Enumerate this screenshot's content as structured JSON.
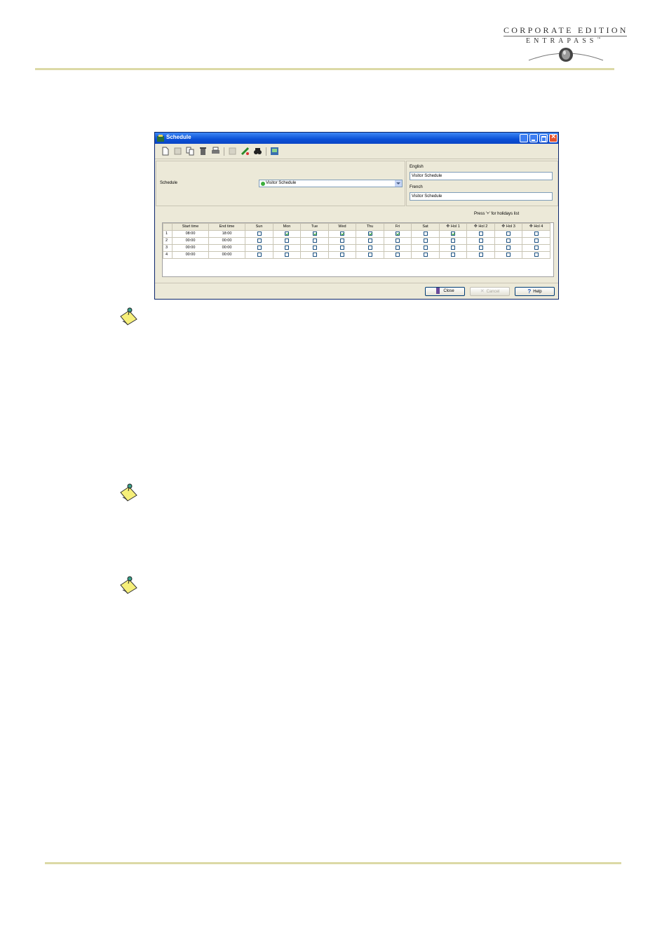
{
  "header": {
    "logo_line1": "CORPORATE EDITION",
    "logo_line2": "ENTRAPASS",
    "logo_tm": "™"
  },
  "window": {
    "title": "Schedule",
    "toolbar_icons": [
      "new-icon",
      "save-icon",
      "copy-icon",
      "delete-icon",
      "print-icon",
      "grid-icon",
      "link-icon",
      "search-icon",
      "help-icon"
    ],
    "schedule_label": "Schedule",
    "schedule_value": "Visitor Schedule",
    "english_label": "English",
    "english_value": "Visitor Schedule",
    "french_label": "French",
    "french_value": "Visitor Schedule",
    "hint": "Press '+' for holidays list",
    "columns": [
      "",
      "Start time",
      "End time",
      "Sun",
      "Mon",
      "Tue",
      "Wed",
      "Thu",
      "Fri",
      "Sat",
      "Hol 1",
      "Hol 2",
      "Hol 3",
      "Hol 4"
    ],
    "rows": [
      {
        "num": "1",
        "start": "08:00",
        "end": "18:00",
        "checks": [
          false,
          true,
          true,
          true,
          true,
          true,
          false,
          true,
          false,
          false,
          false
        ]
      },
      {
        "num": "2",
        "start": "00:00",
        "end": "00:00",
        "checks": [
          false,
          false,
          false,
          false,
          false,
          false,
          false,
          false,
          false,
          false,
          false
        ]
      },
      {
        "num": "3",
        "start": "00:00",
        "end": "00:00",
        "checks": [
          false,
          false,
          false,
          false,
          false,
          false,
          false,
          false,
          false,
          false,
          false
        ]
      },
      {
        "num": "4",
        "start": "00:00",
        "end": "00:00",
        "checks": [
          false,
          false,
          false,
          false,
          false,
          false,
          false,
          false,
          false,
          false,
          false
        ]
      }
    ],
    "buttons": {
      "close": "Close",
      "cancel": "Cancel",
      "help": "Help"
    }
  },
  "notes": [
    "note-icon",
    "note-icon",
    "note-icon"
  ]
}
